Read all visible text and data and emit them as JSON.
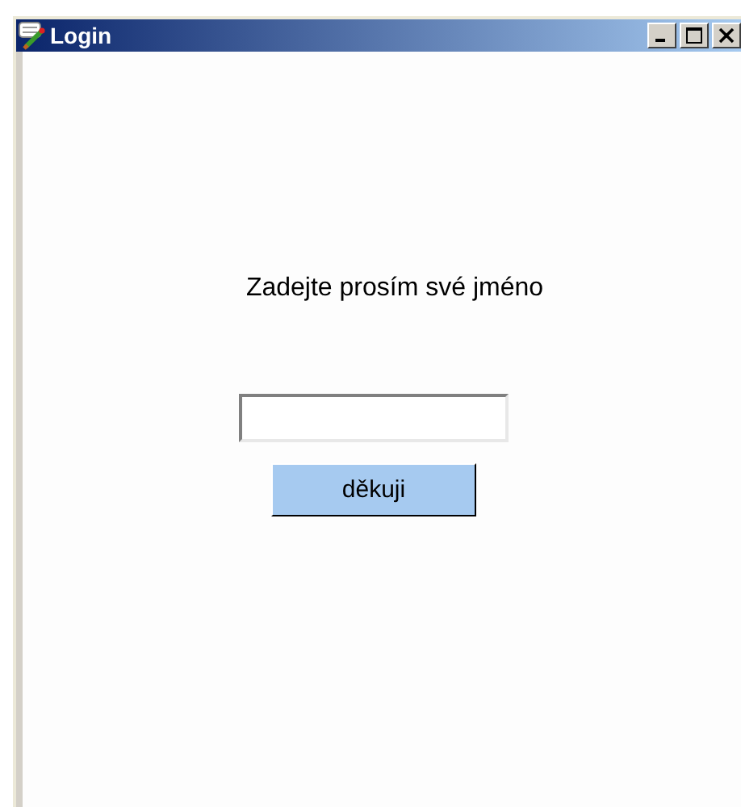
{
  "window": {
    "title": "Login"
  },
  "prompt": "Zadejte prosím své jméno",
  "submit_button": {
    "label": "děkuji"
  }
}
